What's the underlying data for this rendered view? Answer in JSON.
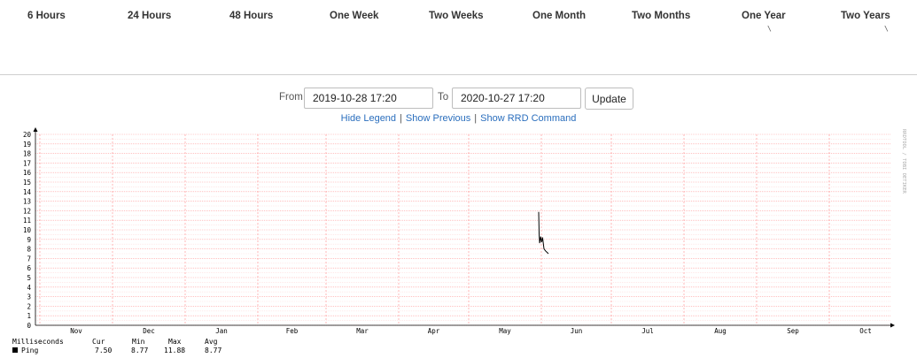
{
  "tabs": [
    {
      "id": "6h",
      "label": "6 Hours"
    },
    {
      "id": "24h",
      "label": "24 Hours"
    },
    {
      "id": "48h",
      "label": "48 Hours"
    },
    {
      "id": "1w",
      "label": "One Week"
    },
    {
      "id": "2w",
      "label": "Two Weeks"
    },
    {
      "id": "1m",
      "label": "One Month"
    },
    {
      "id": "2m",
      "label": "Two Months"
    },
    {
      "id": "1y",
      "label": "One Year"
    },
    {
      "id": "2y",
      "label": "Two Years"
    }
  ],
  "tick_glyph": "\\",
  "range": {
    "from_label": "From",
    "from_value": "2019-10-28 17:20",
    "to_label": "To",
    "to_value": "2020-10-27 17:20",
    "update_label": "Update"
  },
  "links": {
    "hide_legend": "Hide Legend",
    "show_previous": "Show Previous",
    "show_rrd": "Show RRD Command",
    "separator": "|"
  },
  "chart_data": {
    "type": "line",
    "watermark": "RRDTOOL / TOBI OETIKER",
    "ylim": [
      0,
      20
    ],
    "yticks": [
      0,
      1,
      2,
      3,
      4,
      5,
      6,
      7,
      8,
      9,
      10,
      11,
      12,
      13,
      14,
      15,
      16,
      17,
      18,
      19,
      20
    ],
    "xlabels": [
      "Nov",
      "Dec",
      "Jan",
      "Feb",
      "Mar",
      "Apr",
      "May",
      "Jun",
      "Jul",
      "Aug",
      "Sep",
      "Oct"
    ],
    "series": [
      {
        "name": "Ping",
        "color": "#000000",
        "points": [
          [
            0.0,
            11.88
          ],
          [
            0.05,
            9.5
          ],
          [
            0.1,
            8.6
          ],
          [
            0.2,
            9.3
          ],
          [
            0.3,
            8.7
          ],
          [
            0.4,
            9.2
          ],
          [
            0.55,
            8.0
          ],
          [
            0.7,
            7.8
          ],
          [
            1.0,
            7.5
          ]
        ]
      }
    ],
    "legend": {
      "unit_label": "Milliseconds",
      "headers": [
        "Cur",
        "Min",
        "Max",
        "Avg"
      ],
      "rows": [
        {
          "name": "Ping",
          "cur": "7.50",
          "min": "8.77",
          "max": "11.88",
          "avg": "8.77",
          "color": "#000000"
        }
      ]
    }
  },
  "colors": {
    "grid_major": "#ff9a9a",
    "grid_minor": "#ffdcdc",
    "axis": "#000000",
    "link": "#2a6ebd"
  }
}
